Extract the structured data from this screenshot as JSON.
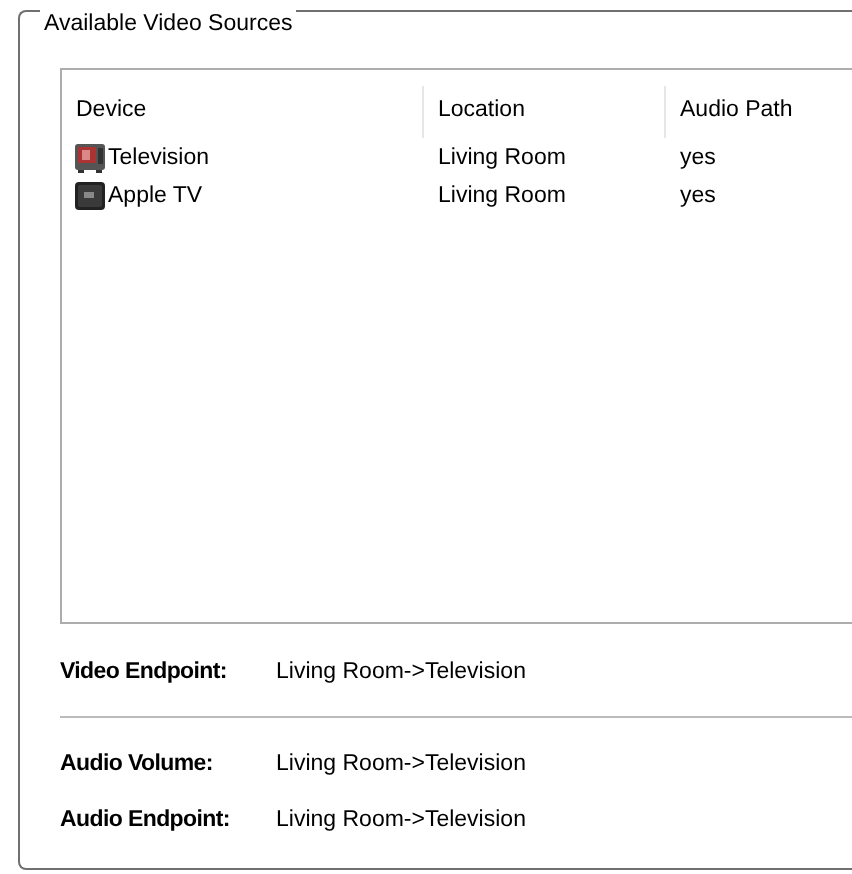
{
  "group": {
    "title": "Available Video Sources"
  },
  "table": {
    "columns": [
      "Device",
      "Location",
      "Audio Path"
    ],
    "rows": [
      {
        "kind": "tv",
        "device": "Television",
        "location": "Living Room",
        "audio_path": "yes"
      },
      {
        "kind": "box",
        "device": "Apple TV",
        "location": "Living Room",
        "audio_path": "yes"
      }
    ]
  },
  "field_groups": [
    [
      {
        "label": "Video Endpoint:",
        "value": "Living Room->Television"
      }
    ],
    [
      {
        "label": "Audio Volume:",
        "value": "Living Room->Television"
      },
      {
        "label": "Audio Endpoint:",
        "value": "Living Room->Television"
      }
    ]
  ]
}
